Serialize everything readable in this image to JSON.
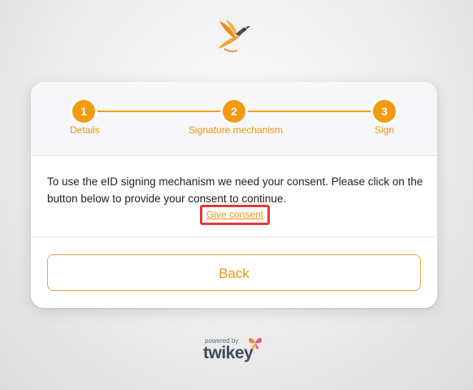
{
  "steps": [
    {
      "number": "1",
      "label": "Details"
    },
    {
      "number": "2",
      "label": "Signature mechanism"
    },
    {
      "number": "3",
      "label": "Sign"
    }
  ],
  "message": "To use the eID signing mechanism we need your consent. Please click on the button below to provide your consent to continue.",
  "consent_link": "Give consent",
  "back_button": "Back",
  "footer": {
    "powered_by": "powered by",
    "brand": "twikey"
  },
  "colors": {
    "accent": "#f29a12",
    "highlight_border": "#e0393e",
    "brand_text": "#3e4a5e"
  },
  "icons": {
    "logo": "bird-logo-icon",
    "footer": "butterfly-icon"
  }
}
